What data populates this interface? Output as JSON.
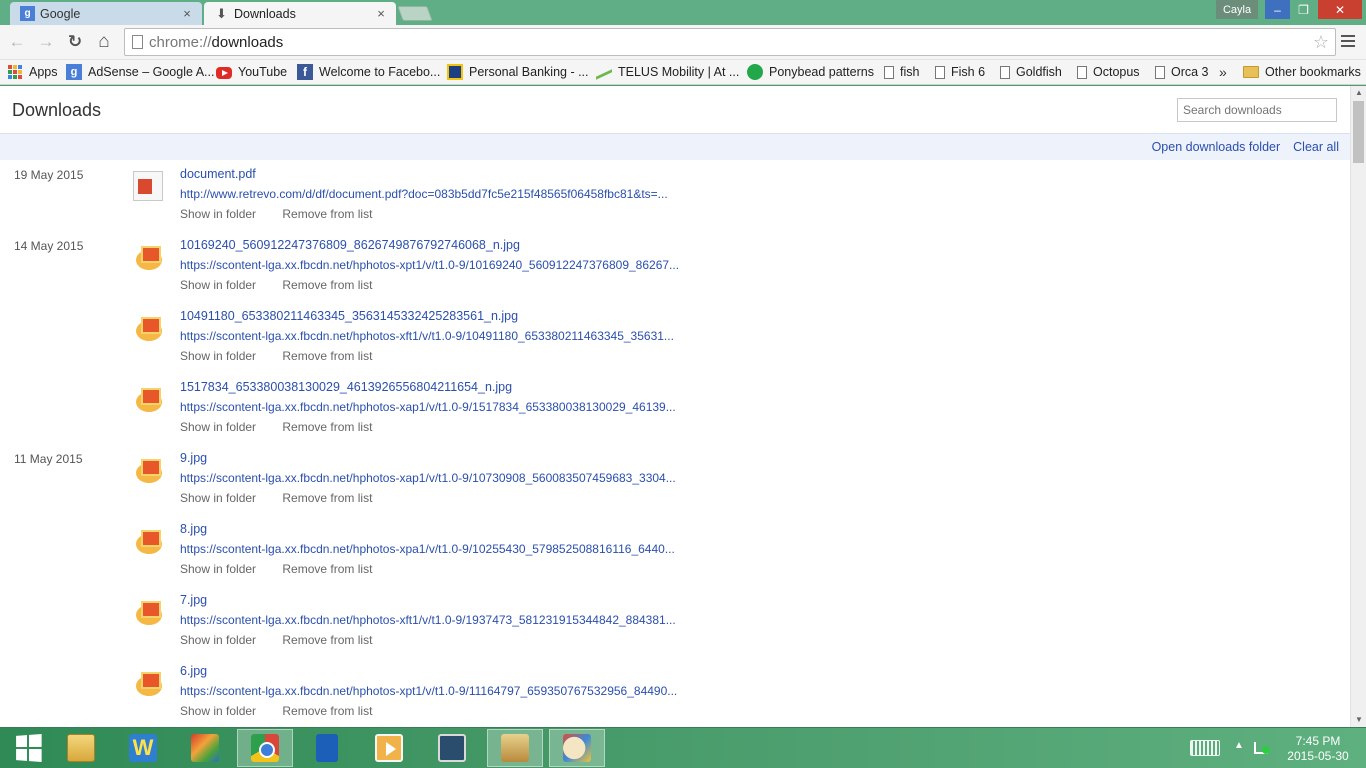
{
  "window": {
    "tabs": [
      {
        "title": "Google",
        "close": "×",
        "active": false
      },
      {
        "title": "Downloads",
        "close": "×",
        "active": true
      }
    ],
    "user": "Cayla",
    "controls": {
      "minimize": "–",
      "maximize": "❐",
      "close": "✕"
    }
  },
  "toolbar": {
    "back": "←",
    "forward": "→",
    "reload": "↻",
    "home": "⌂",
    "address_scheme": "chrome://",
    "address_host": "downloads",
    "star": "☆"
  },
  "bookmarks": [
    {
      "label": "Apps",
      "icon": "apps-grid-icon"
    },
    {
      "label": "AdSense – Google A...",
      "icon": "google-icon"
    },
    {
      "label": "YouTube",
      "icon": "youtube-icon"
    },
    {
      "label": "Welcome to Facebo...",
      "icon": "facebook-icon"
    },
    {
      "label": "Personal Banking - ...",
      "icon": "bank-icon"
    },
    {
      "label": "TELUS Mobility | At ...",
      "icon": "telus-icon"
    },
    {
      "label": "Ponybead patterns",
      "icon": "ponybead-icon"
    },
    {
      "label": "fish",
      "icon": "page-icon"
    },
    {
      "label": "Fish 6",
      "icon": "page-icon"
    },
    {
      "label": "Goldfish",
      "icon": "page-icon"
    },
    {
      "label": "Octopus",
      "icon": "page-icon"
    },
    {
      "label": "Orca 3",
      "icon": "page-icon"
    }
  ],
  "bookmarks_more": "»",
  "other_bookmarks": "Other bookmarks",
  "page": {
    "title": "Downloads",
    "search_placeholder": "Search downloads",
    "open_folder": "Open downloads folder",
    "clear_all": "Clear all"
  },
  "downloads": [
    {
      "date": "19 May 2015",
      "type": "pdf",
      "name": "document.pdf",
      "url": "http://www.retrevo.com/d/df/document.pdf?doc=083b5dd7fc5e215f48565f06458fbc81&ts=...",
      "show": "Show in folder",
      "remove": "Remove from list"
    },
    {
      "date": "14 May 2015",
      "type": "image",
      "name": "10169240_560912247376809_8626749876792746068_n.jpg",
      "url": "https://scontent-lga.xx.fbcdn.net/hphotos-xpt1/v/t1.0-9/10169240_560912247376809_86267...",
      "show": "Show in folder",
      "remove": "Remove from list"
    },
    {
      "date": "",
      "type": "image",
      "name": "10491180_653380211463345_3563145332425283561_n.jpg",
      "url": "https://scontent-lga.xx.fbcdn.net/hphotos-xft1/v/t1.0-9/10491180_653380211463345_35631...",
      "show": "Show in folder",
      "remove": "Remove from list"
    },
    {
      "date": "",
      "type": "image",
      "name": "1517834_653380038130029_4613926556804211654_n.jpg",
      "url": "https://scontent-lga.xx.fbcdn.net/hphotos-xap1/v/t1.0-9/1517834_653380038130029_46139...",
      "show": "Show in folder",
      "remove": "Remove from list"
    },
    {
      "date": "11 May 2015",
      "type": "image",
      "name": "9.jpg",
      "url": "https://scontent-lga.xx.fbcdn.net/hphotos-xap1/v/t1.0-9/10730908_560083507459683_3304...",
      "show": "Show in folder",
      "remove": "Remove from list"
    },
    {
      "date": "",
      "type": "image",
      "name": "8.jpg",
      "url": "https://scontent-lga.xx.fbcdn.net/hphotos-xpa1/v/t1.0-9/10255430_579852508816116_6440...",
      "show": "Show in folder",
      "remove": "Remove from list"
    },
    {
      "date": "",
      "type": "image",
      "name": "7.jpg",
      "url": "https://scontent-lga.xx.fbcdn.net/hphotos-xft1/v/t1.0-9/1937473_581231915344842_884381...",
      "show": "Show in folder",
      "remove": "Remove from list"
    },
    {
      "date": "",
      "type": "image",
      "name": "6.jpg",
      "url": "https://scontent-lga.xx.fbcdn.net/hphotos-xpt1/v/t1.0-9/11164797_659350767532956_84490...",
      "show": "Show in folder",
      "remove": "Remove from list"
    }
  ],
  "taskbar": {
    "apps": [
      {
        "name": "start-button",
        "icon": "windows-start-icon"
      },
      {
        "name": "taskbar-file-explorer",
        "icon": "file-explorer-icon"
      },
      {
        "name": "taskbar-wordperfect",
        "icon": "wordperfect-icon",
        "glyph": "W"
      },
      {
        "name": "taskbar-avg",
        "icon": "avg-icon"
      },
      {
        "name": "taskbar-chrome",
        "icon": "chrome-icon"
      },
      {
        "name": "taskbar-malwarebytes",
        "icon": "malwarebytes-icon"
      },
      {
        "name": "taskbar-video-player",
        "icon": "video-player-icon"
      },
      {
        "name": "taskbar-media-center",
        "icon": "film-icon"
      },
      {
        "name": "taskbar-bank-app",
        "icon": "bank-building-icon"
      },
      {
        "name": "taskbar-paint",
        "icon": "paint-palette-icon"
      }
    ],
    "tray_up": "▲",
    "time": "7:45 PM",
    "date": "2015-05-30"
  }
}
